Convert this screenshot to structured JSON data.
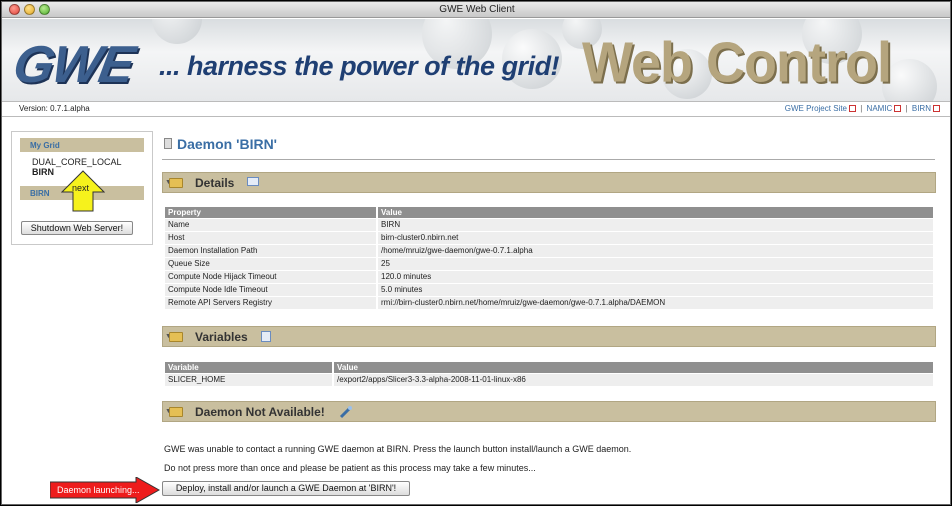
{
  "window": {
    "title": "GWE Web Client"
  },
  "banner": {
    "logo_text": "GWE",
    "tagline": "... harness the power of the grid!",
    "panel_title": "Web Control Panel"
  },
  "version_bar": {
    "version": "Version: 0.7.1.alpha",
    "links": [
      "GWE Project Site",
      "NAMIC",
      "BIRN"
    ]
  },
  "sidebar": {
    "my_grid_header": "My Grid",
    "items": [
      "DUAL_CORE_LOCAL",
      "BIRN"
    ],
    "birn_header": "BIRN",
    "shutdown_button": "Shutdown Web Server!"
  },
  "annotations": {
    "next_label": "next",
    "daemon_launching": "Daemon launching..."
  },
  "main": {
    "title": "Daemon 'BIRN'",
    "details": {
      "title": "Details",
      "headers": [
        "Property",
        "Value"
      ],
      "rows": [
        [
          "Name",
          "BIRN"
        ],
        [
          "Host",
          "birn-cluster0.nbirn.net"
        ],
        [
          "Daemon Installation Path",
          "/home/mruiz/gwe-daemon/gwe-0.7.1.alpha"
        ],
        [
          "Queue Size",
          "25"
        ],
        [
          "Compute Node Hijack Timeout",
          "120.0 minutes"
        ],
        [
          "Compute Node Idle Timeout",
          "5.0 minutes"
        ],
        [
          "Remote API Servers Registry",
          "rmi://birn-cluster0.nbirn.net/home/mruiz/gwe-daemon/gwe-0.7.1.alpha/DAEMON"
        ]
      ]
    },
    "variables": {
      "title": "Variables",
      "headers": [
        "Variable",
        "Value"
      ],
      "rows": [
        [
          "SLICER_HOME",
          "/export2/apps/Slicer3-3.3-alpha-2008-11-01-linux-x86"
        ]
      ]
    },
    "status": {
      "title": "Daemon Not Available!",
      "message1": "GWE was unable to contact a running GWE daemon at BIRN. Press the launch button install/launch a GWE daemon.",
      "message2": "Do not press more than once and please be patient as this process may take a few minutes...",
      "deploy_button": "Deploy, install and/or launch a GWE Daemon at 'BIRN'!"
    }
  }
}
